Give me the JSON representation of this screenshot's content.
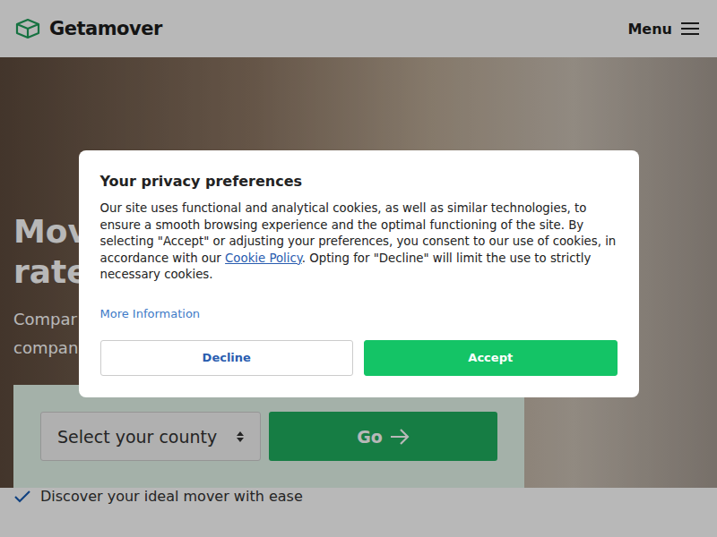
{
  "header": {
    "logo": "Getamover",
    "menu": "Menu"
  },
  "hero": {
    "title_lines": [
      "Mov",
      "rate"
    ],
    "subtitle_lines": [
      "Compar",
      "compan"
    ]
  },
  "search": {
    "placeholder": "Select your county",
    "button": "Go"
  },
  "features": [
    "Discover your ideal mover with ease"
  ],
  "cookie_dialog": {
    "title": "Your privacy preferences",
    "body_before": "Our site uses functional and analytical cookies, as well as similar technologies, to ensure a smooth browsing experience and the optimal functioning of the site. By selecting \"Accept\" or adjusting your preferences, you consent to our use of cookies, in accordance with our ",
    "link": "Cookie Policy",
    "body_after": ". Opting for \"Decline\" will limit the use to strictly necessary cookies.",
    "more": "More Information",
    "buttons": [
      "Decline",
      "Accept"
    ]
  }
}
